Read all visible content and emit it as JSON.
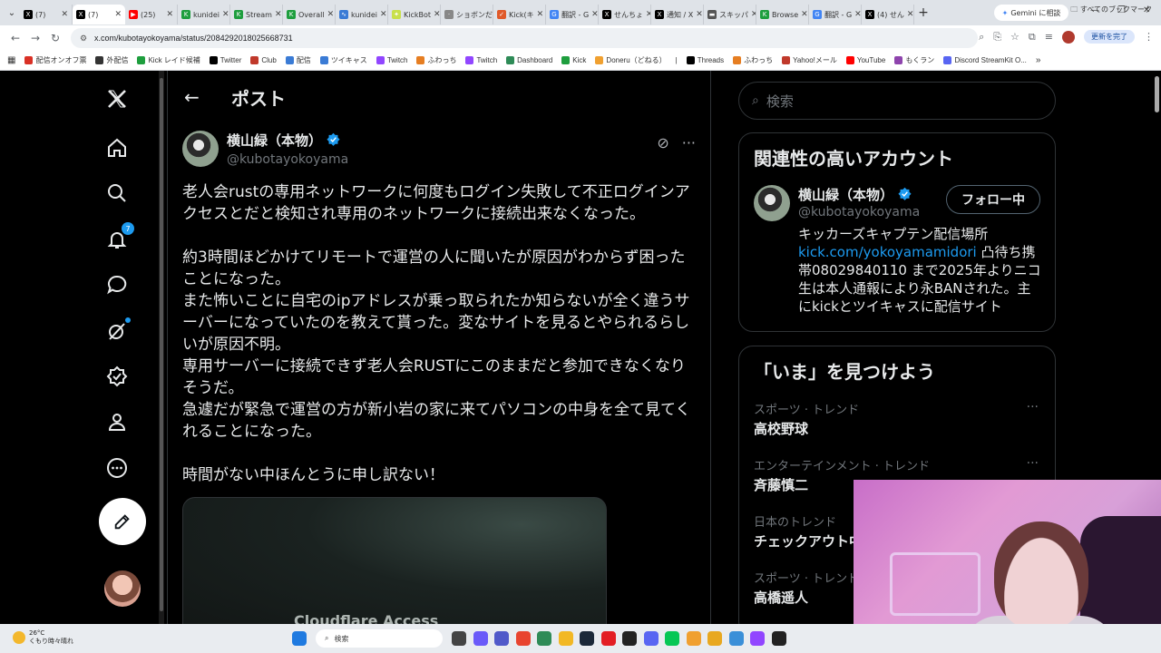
{
  "browser": {
    "tabs": [
      {
        "label": "(7)",
        "color": "#000000",
        "glyph": "X",
        "active": false
      },
      {
        "label": "(7)",
        "color": "#000000",
        "glyph": "X",
        "active": true
      },
      {
        "label": "(25)",
        "color": "#ff0000",
        "glyph": "▶",
        "active": false
      },
      {
        "label": "kunidei",
        "color": "#1e9e3e",
        "glyph": "K",
        "active": false
      },
      {
        "label": "Stream",
        "color": "#1e9e3e",
        "glyph": "K",
        "active": false
      },
      {
        "label": "Overall",
        "color": "#1e9e3e",
        "glyph": "K",
        "active": false
      },
      {
        "label": "kunidei",
        "color": "#3a7bd5",
        "glyph": "∿",
        "active": false
      },
      {
        "label": "KickBot",
        "color": "#c8e04a",
        "glyph": "✦",
        "active": false
      },
      {
        "label": "ショボンだ",
        "color": "#888888",
        "glyph": "·",
        "active": false
      },
      {
        "label": "Kick(キ",
        "color": "#e05a2a",
        "glyph": "✓",
        "active": false
      },
      {
        "label": "翻訳 - G",
        "color": "#4285f4",
        "glyph": "G",
        "active": false
      },
      {
        "label": "せんちょ",
        "color": "#000000",
        "glyph": "X",
        "active": false
      },
      {
        "label": "通知 / X",
        "color": "#000000",
        "glyph": "X",
        "active": false
      },
      {
        "label": "スキッパ",
        "color": "#555555",
        "glyph": "▬",
        "active": false
      },
      {
        "label": "Browse",
        "color": "#1e9e3e",
        "glyph": "K",
        "active": false
      },
      {
        "label": "翻訳 - G",
        "color": "#4285f4",
        "glyph": "G",
        "active": false
      },
      {
        "label": "(4) せん",
        "color": "#000000",
        "glyph": "X",
        "active": false
      }
    ],
    "new_tab": "+",
    "gemini_label": "Gemini に相談",
    "url": "x.com/kubotayokoyama/status/2084292018025668731",
    "update_label": "更新を完了",
    "bookmarks": [
      "配信オンオフ票",
      "外配信",
      "Kick レイド候補",
      "Twitter",
      "Club",
      "配信",
      "ツイキャス",
      "Twitch",
      "ふわっち",
      "Twitch",
      "Dashboard",
      "Kick",
      "Doneru（どねる）",
      "|",
      "Threads",
      "ふわっち",
      "Yahoo!メール",
      "YouTube",
      "もくラン",
      "Discord StreamKit O..."
    ],
    "all_bookmarks": "すべてのブックマーク"
  },
  "nav": {
    "notifications_badge": "7"
  },
  "post": {
    "header_title": "ポスト",
    "author_name": "横山緑（本物）",
    "author_handle": "@kubotayokoyama",
    "body": "老人会rustの専用ネットワークに何度もログイン失敗して不正ログインアクセスとだと検知され専用のネットワークに接続出来なくなった。\n\n約3時間ほどかけてリモートで運営の人に聞いたが原因がわからず困ったことになった。\nまた怖いことに自宅のipアドレスが乗っ取られたか知らないが全く違うサーバーになっていたのを教えて貰った。変なサイトを見るとやられるらしいが原因不明。\n専用サーバーに接続できず老人会RUSTにこのままだと参加できなくなりそうだ。\n急遽だが緊急で運営の方が新小岩の家に来てパソコンの中身を全て見てくれることになった。\n\n時間がない中ほんとうに申し訳ない！",
    "media_caption": "Cloudflare Access"
  },
  "sidebar": {
    "search_placeholder": "検索",
    "related_title": "関連性の高いアカウント",
    "account": {
      "name": "横山緑（本物）",
      "handle": "@kubotayokoyama",
      "follow_label": "フォロー中",
      "bio_before": "キッカーズキャプテン配信場所",
      "bio_link": "kick.com/yokoyamamidori",
      "bio_after": " 凸待ち携帯08029840110 まで2025年よりニコ生は本人通報により永BANされた。主にkickとツイキャスに配信サイト"
    },
    "trends_title": "「いま」を見つけよう",
    "trends": [
      {
        "category": "スポーツ · トレンド",
        "name": "高校野球"
      },
      {
        "category": "エンターテインメント · トレンド",
        "name": "斉藤慎二"
      },
      {
        "category": "日本のトレンド",
        "name": "チェックアウト中"
      },
      {
        "category": "スポーツ · トレンド",
        "name": "高橋遥人"
      }
    ]
  },
  "taskbar": {
    "temperature": "26°C",
    "weather": "くもり時々晴れ",
    "search_placeholder": "検索"
  },
  "colors": {
    "accent": "#1d9bf0",
    "background": "#000000",
    "border": "#2f3336",
    "muted": "#71767b"
  }
}
